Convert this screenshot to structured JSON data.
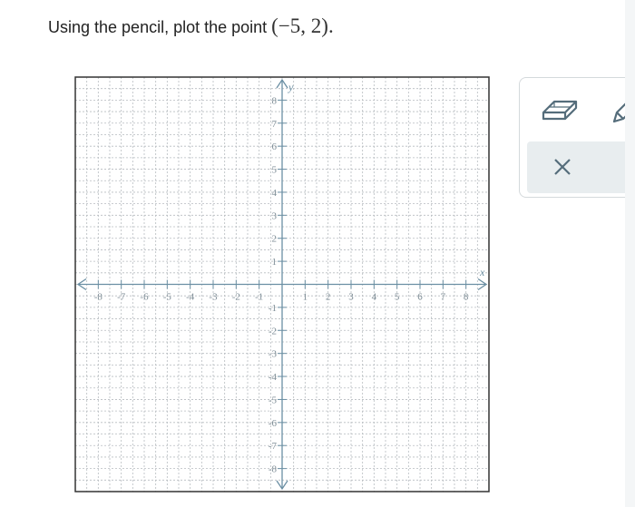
{
  "prompt": {
    "text": "Using the pencil, plot the point ",
    "math": "(−5, 2)",
    "end": "."
  },
  "graph": {
    "x_axis_label": "x",
    "y_axis_label": "y",
    "x_ticks": [
      "-8",
      "-7",
      "-6",
      "-5",
      "-4",
      "-3",
      "-2",
      "-1",
      "1",
      "2",
      "3",
      "4",
      "5",
      "6",
      "7",
      "8"
    ],
    "y_ticks": [
      "8",
      "7",
      "6",
      "5",
      "4",
      "3",
      "2",
      "1",
      "-1",
      "-2",
      "-3",
      "-4",
      "-5",
      "-6",
      "-7",
      "-8"
    ],
    "x_range": [
      -9,
      9
    ],
    "y_range": [
      -9,
      9
    ],
    "grid": true,
    "axis_color": "#6b8fa3",
    "grid_color": "#b7bcc0"
  },
  "toolbar": {
    "tools": [
      "eraser-icon",
      "pencil-icon"
    ],
    "actions": [
      "close-icon",
      "undo-icon"
    ]
  }
}
